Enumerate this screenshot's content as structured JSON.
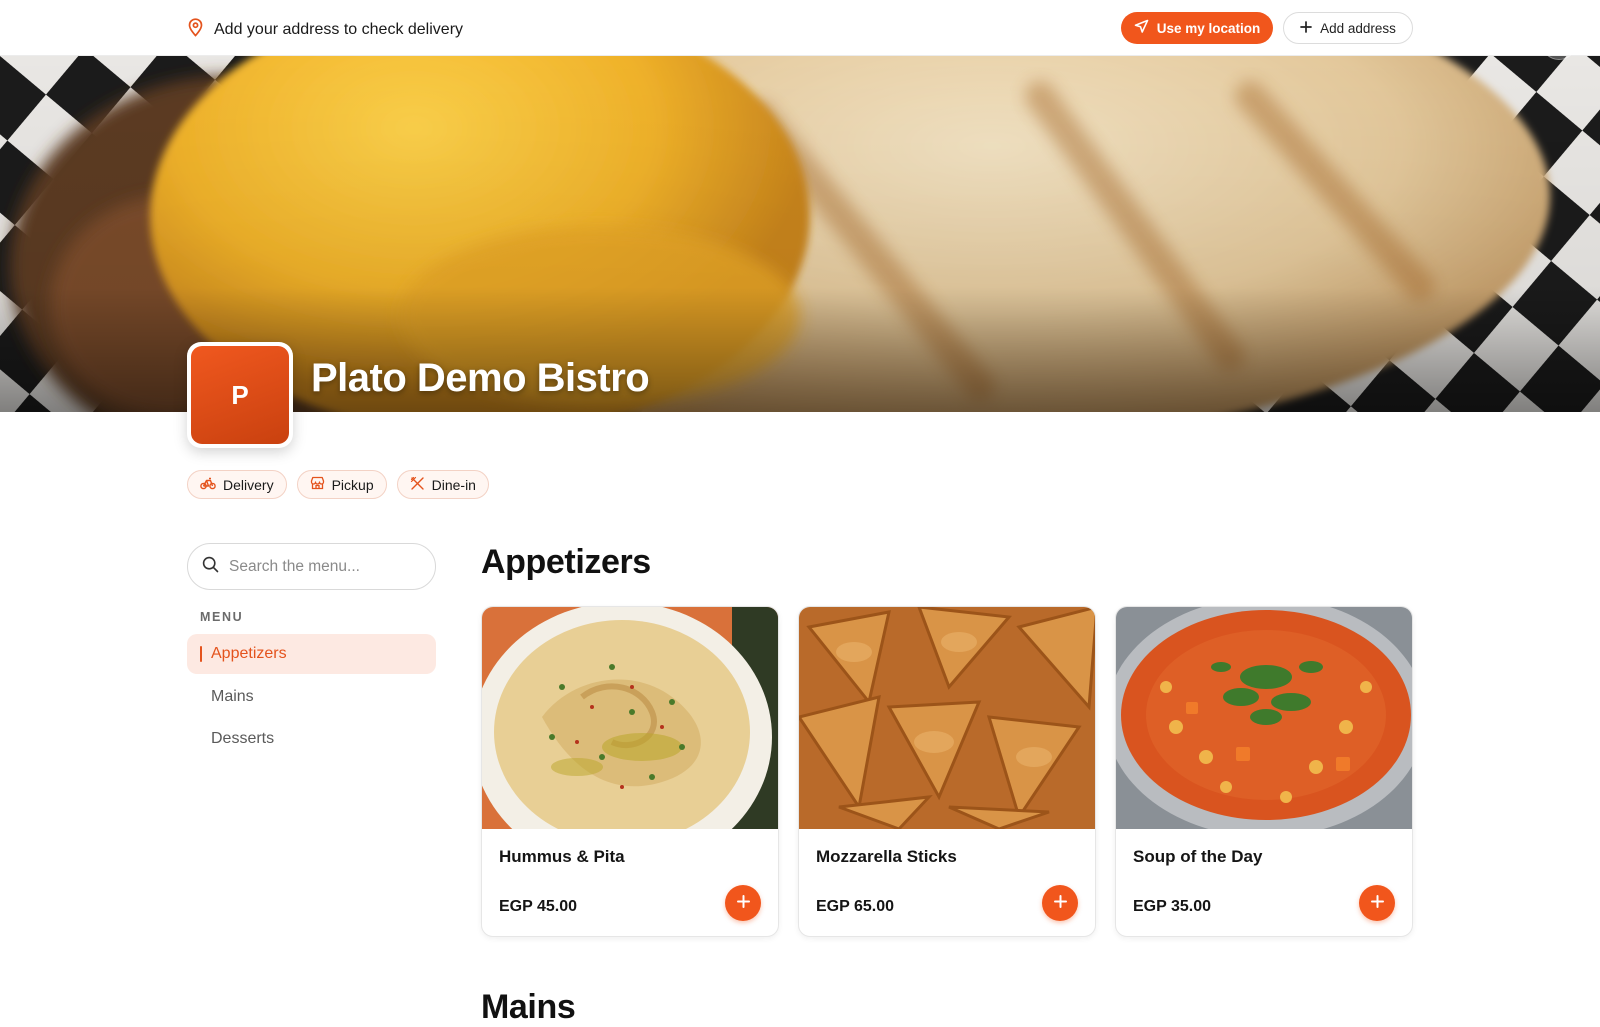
{
  "topbar": {
    "address_prompt": "Add your address to check delivery",
    "use_location_label": "Use my location",
    "add_address_label": "Add address"
  },
  "restaurant": {
    "name": "Plato Demo Bistro",
    "logo_letter": "P"
  },
  "services": [
    {
      "label": "Delivery",
      "icon": "bicycle-icon"
    },
    {
      "label": "Pickup",
      "icon": "store-icon"
    },
    {
      "label": "Dine-in",
      "icon": "utensils-icon"
    }
  ],
  "sidebar": {
    "search_placeholder": "Search the menu...",
    "menu_heading": "MENU",
    "items": [
      {
        "label": "Appetizers",
        "active": true
      },
      {
        "label": "Mains",
        "active": false
      },
      {
        "label": "Desserts",
        "active": false
      }
    ]
  },
  "main": {
    "section_title": "Appetizers",
    "next_section_title": "Mains",
    "items": [
      {
        "name": "Hummus & Pita",
        "price": "EGP 45.00",
        "image": "hummus-image"
      },
      {
        "name": "Mozzarella Sticks",
        "price": "EGP 65.00",
        "image": "pastries-image"
      },
      {
        "name": "Soup of the Day",
        "price": "EGP 35.00",
        "image": "soup-image"
      }
    ]
  },
  "colors": {
    "accent": "#f1561c",
    "accent_soft": "#fde9e2",
    "text": "#111111"
  }
}
